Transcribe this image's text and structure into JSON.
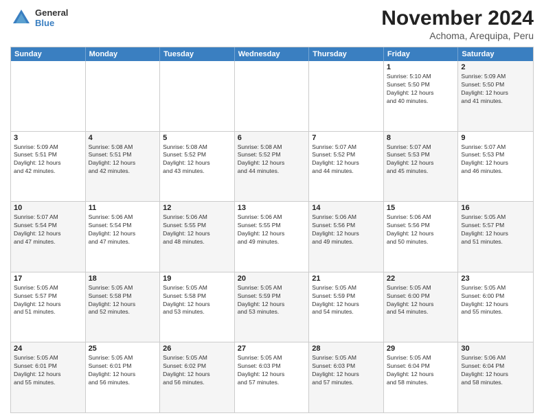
{
  "logo": {
    "line1": "General",
    "line2": "Blue"
  },
  "title": "November 2024",
  "subtitle": "Achoma, Arequipa, Peru",
  "days_of_week": [
    "Sunday",
    "Monday",
    "Tuesday",
    "Wednesday",
    "Thursday",
    "Friday",
    "Saturday"
  ],
  "weeks": [
    [
      {
        "day": "",
        "info": "",
        "alt": false,
        "empty": true
      },
      {
        "day": "",
        "info": "",
        "alt": false,
        "empty": true
      },
      {
        "day": "",
        "info": "",
        "alt": false,
        "empty": true
      },
      {
        "day": "",
        "info": "",
        "alt": false,
        "empty": true
      },
      {
        "day": "",
        "info": "",
        "alt": false,
        "empty": true
      },
      {
        "day": "1",
        "info": "Sunrise: 5:10 AM\nSunset: 5:50 PM\nDaylight: 12 hours\nand 40 minutes.",
        "alt": false,
        "empty": false
      },
      {
        "day": "2",
        "info": "Sunrise: 5:09 AM\nSunset: 5:50 PM\nDaylight: 12 hours\nand 41 minutes.",
        "alt": true,
        "empty": false
      }
    ],
    [
      {
        "day": "3",
        "info": "Sunrise: 5:09 AM\nSunset: 5:51 PM\nDaylight: 12 hours\nand 42 minutes.",
        "alt": false,
        "empty": false
      },
      {
        "day": "4",
        "info": "Sunrise: 5:08 AM\nSunset: 5:51 PM\nDaylight: 12 hours\nand 42 minutes.",
        "alt": true,
        "empty": false
      },
      {
        "day": "5",
        "info": "Sunrise: 5:08 AM\nSunset: 5:52 PM\nDaylight: 12 hours\nand 43 minutes.",
        "alt": false,
        "empty": false
      },
      {
        "day": "6",
        "info": "Sunrise: 5:08 AM\nSunset: 5:52 PM\nDaylight: 12 hours\nand 44 minutes.",
        "alt": true,
        "empty": false
      },
      {
        "day": "7",
        "info": "Sunrise: 5:07 AM\nSunset: 5:52 PM\nDaylight: 12 hours\nand 44 minutes.",
        "alt": false,
        "empty": false
      },
      {
        "day": "8",
        "info": "Sunrise: 5:07 AM\nSunset: 5:53 PM\nDaylight: 12 hours\nand 45 minutes.",
        "alt": true,
        "empty": false
      },
      {
        "day": "9",
        "info": "Sunrise: 5:07 AM\nSunset: 5:53 PM\nDaylight: 12 hours\nand 46 minutes.",
        "alt": false,
        "empty": false
      }
    ],
    [
      {
        "day": "10",
        "info": "Sunrise: 5:07 AM\nSunset: 5:54 PM\nDaylight: 12 hours\nand 47 minutes.",
        "alt": true,
        "empty": false
      },
      {
        "day": "11",
        "info": "Sunrise: 5:06 AM\nSunset: 5:54 PM\nDaylight: 12 hours\nand 47 minutes.",
        "alt": false,
        "empty": false
      },
      {
        "day": "12",
        "info": "Sunrise: 5:06 AM\nSunset: 5:55 PM\nDaylight: 12 hours\nand 48 minutes.",
        "alt": true,
        "empty": false
      },
      {
        "day": "13",
        "info": "Sunrise: 5:06 AM\nSunset: 5:55 PM\nDaylight: 12 hours\nand 49 minutes.",
        "alt": false,
        "empty": false
      },
      {
        "day": "14",
        "info": "Sunrise: 5:06 AM\nSunset: 5:56 PM\nDaylight: 12 hours\nand 49 minutes.",
        "alt": true,
        "empty": false
      },
      {
        "day": "15",
        "info": "Sunrise: 5:06 AM\nSunset: 5:56 PM\nDaylight: 12 hours\nand 50 minutes.",
        "alt": false,
        "empty": false
      },
      {
        "day": "16",
        "info": "Sunrise: 5:05 AM\nSunset: 5:57 PM\nDaylight: 12 hours\nand 51 minutes.",
        "alt": true,
        "empty": false
      }
    ],
    [
      {
        "day": "17",
        "info": "Sunrise: 5:05 AM\nSunset: 5:57 PM\nDaylight: 12 hours\nand 51 minutes.",
        "alt": false,
        "empty": false
      },
      {
        "day": "18",
        "info": "Sunrise: 5:05 AM\nSunset: 5:58 PM\nDaylight: 12 hours\nand 52 minutes.",
        "alt": true,
        "empty": false
      },
      {
        "day": "19",
        "info": "Sunrise: 5:05 AM\nSunset: 5:58 PM\nDaylight: 12 hours\nand 53 minutes.",
        "alt": false,
        "empty": false
      },
      {
        "day": "20",
        "info": "Sunrise: 5:05 AM\nSunset: 5:59 PM\nDaylight: 12 hours\nand 53 minutes.",
        "alt": true,
        "empty": false
      },
      {
        "day": "21",
        "info": "Sunrise: 5:05 AM\nSunset: 5:59 PM\nDaylight: 12 hours\nand 54 minutes.",
        "alt": false,
        "empty": false
      },
      {
        "day": "22",
        "info": "Sunrise: 5:05 AM\nSunset: 6:00 PM\nDaylight: 12 hours\nand 54 minutes.",
        "alt": true,
        "empty": false
      },
      {
        "day": "23",
        "info": "Sunrise: 5:05 AM\nSunset: 6:00 PM\nDaylight: 12 hours\nand 55 minutes.",
        "alt": false,
        "empty": false
      }
    ],
    [
      {
        "day": "24",
        "info": "Sunrise: 5:05 AM\nSunset: 6:01 PM\nDaylight: 12 hours\nand 55 minutes.",
        "alt": true,
        "empty": false
      },
      {
        "day": "25",
        "info": "Sunrise: 5:05 AM\nSunset: 6:01 PM\nDaylight: 12 hours\nand 56 minutes.",
        "alt": false,
        "empty": false
      },
      {
        "day": "26",
        "info": "Sunrise: 5:05 AM\nSunset: 6:02 PM\nDaylight: 12 hours\nand 56 minutes.",
        "alt": true,
        "empty": false
      },
      {
        "day": "27",
        "info": "Sunrise: 5:05 AM\nSunset: 6:03 PM\nDaylight: 12 hours\nand 57 minutes.",
        "alt": false,
        "empty": false
      },
      {
        "day": "28",
        "info": "Sunrise: 5:05 AM\nSunset: 6:03 PM\nDaylight: 12 hours\nand 57 minutes.",
        "alt": true,
        "empty": false
      },
      {
        "day": "29",
        "info": "Sunrise: 5:05 AM\nSunset: 6:04 PM\nDaylight: 12 hours\nand 58 minutes.",
        "alt": false,
        "empty": false
      },
      {
        "day": "30",
        "info": "Sunrise: 5:06 AM\nSunset: 6:04 PM\nDaylight: 12 hours\nand 58 minutes.",
        "alt": true,
        "empty": false
      }
    ]
  ]
}
